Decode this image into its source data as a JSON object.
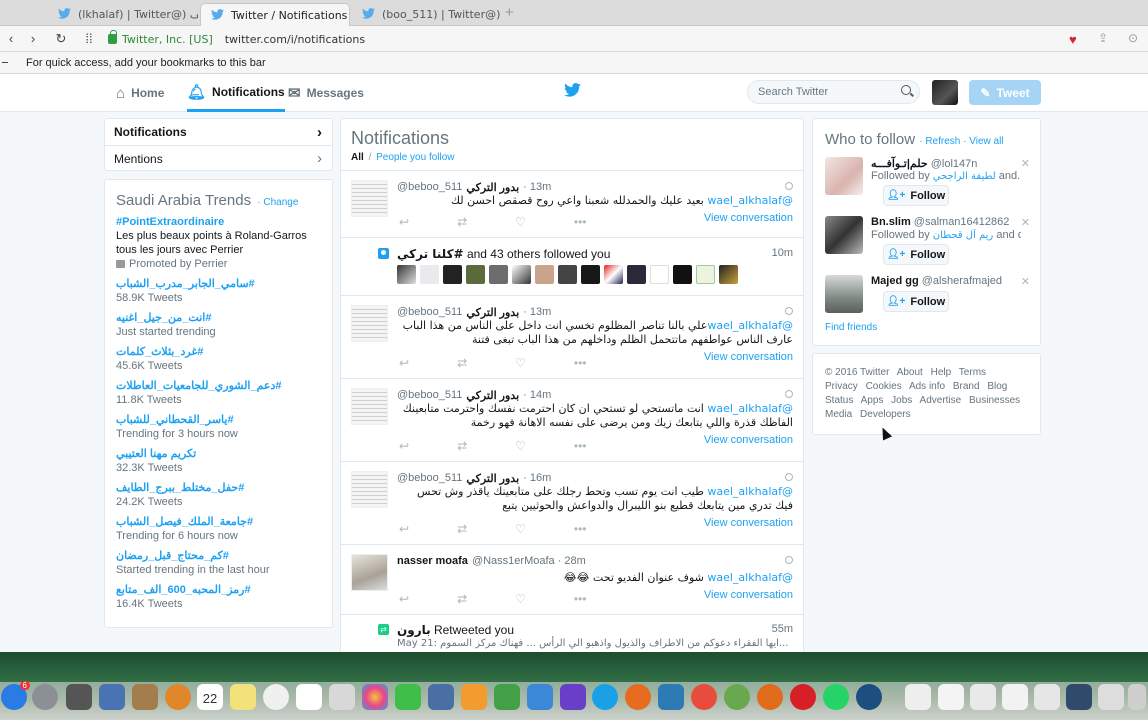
{
  "browser": {
    "tabs": [
      {
        "label": "(lkhalaf) | Twitter@) وائل الخلف"
      },
      {
        "label": "Twitter / Notifications"
      },
      {
        "label": "(boo_511) | Twitter@) بدور التركي"
      }
    ],
    "url_owner": "Twitter, Inc. [US]",
    "url": "twitter.com/i/notifications",
    "bookmarks_hint": "For quick access, add your bookmarks to this bar"
  },
  "nav": {
    "home": "Home",
    "notifications": "Notifications",
    "messages": "Messages",
    "search_placeholder": "Search Twitter",
    "tweet_button": "Tweet"
  },
  "left_menu": {
    "items": [
      {
        "label": "Notifications"
      },
      {
        "label": "Mentions"
      }
    ]
  },
  "trends": {
    "title": "Saudi Arabia Trends",
    "change": "Change",
    "items": [
      {
        "name": "#PointExtraordinaire",
        "desc": "Les plus beaux points à Roland-Garros tous les jours avec Perrier",
        "meta": "Promoted by Perrier"
      },
      {
        "name": "#سامي_الجابر_مدرب_الشباب",
        "meta": "58.9K Tweets"
      },
      {
        "name": "#انت_من_جيل_اغنيه",
        "meta": "Just started trending"
      },
      {
        "name": "#غرد_بثلاث_كلمات",
        "meta": "45.6K Tweets"
      },
      {
        "name": "#دعم_الشوري_للجامعيات_العاطلات",
        "meta": "11.8K Tweets"
      },
      {
        "name": "#ياسر_القحطاني_للشباب",
        "meta": "Trending for 3 hours now"
      },
      {
        "name": "تكريم مهنا العتيبي",
        "meta": "32.3K Tweets"
      },
      {
        "name": "#حفل_مختلط_ببرج_الطايف",
        "meta": "24.2K Tweets"
      },
      {
        "name": "#جامعة_الملك_فيصل_الشباب",
        "meta": "Trending for 6 hours now"
      },
      {
        "name": "#كم_محتاج_قبل_رمضان",
        "meta": "Started trending in the last hour"
      },
      {
        "name": "#رمز_المحبه_600_الف_متابع",
        "meta": "16.4K Tweets"
      }
    ]
  },
  "stream": {
    "title": "Notifications",
    "filter_all": "All",
    "filter_separator": "/",
    "filter_people": "People you follow",
    "view_conversation": "View conversation",
    "tweets": [
      {
        "name": "بدور التركي",
        "handle": "@beboo_511",
        "time": "· 13m",
        "mention": "@wael_alkhalaf",
        "text": "بعيد عليك والحمدلله شعبنا واعي روح قصقص احسن لك"
      },
      {
        "name": "بدور التركي",
        "handle": "@beboo_511",
        "time": "· 13m",
        "mention": "@wael_alkhalaf",
        "text": "علي بالنا تناصر المظلوم تخسي انت داخل على الناس من هذا الباب عارف الناس عواطفهم ماتتحمل الظلم وداخلهم من هذا الباب تبغى فتنة"
      },
      {
        "name": "بدور التركي",
        "handle": "@beboo_511",
        "time": "· 14m",
        "mention": "@wael_alkhalaf",
        "text": "انت ماتستحي لو تستحي ان كان احترمت نفسك واحترمت متابعينك الفاظك قذرة واللي يتابعك زيك ومن يرضى على نفسه الاهانة فهو رخمة"
      },
      {
        "name": "بدور التركي",
        "handle": "@beboo_511",
        "time": "· 16m",
        "mention": "@wael_alkhalaf",
        "text": "طيب انت يوم تسب وتحط رجلك على متابعينك ياقذر وش تحس فيك تدري مين يتابعك قطيع بنو الليبرال والدواعش والحوثيين يتبع"
      },
      {
        "name": "nasser moafa",
        "handle": "@Nass1erMoafa",
        "time": "· 28m",
        "mention": "@wael_alkhalaf",
        "text": "شوف عنوان الفديو تحت 😂😂"
      }
    ],
    "follow_notice": {
      "name": "#كلنا تركي",
      "rest": "and 43 others followed you",
      "time": "10m"
    },
    "retweet_notice": {
      "name": "بارون",
      "rest": "Retweeted you",
      "time": "55m",
      "preview": "May 21: ايها الفقراء دعوكم من الاطراف والذيول واذهبو الي الرأس ... فهناك مركز السموم..."
    }
  },
  "who_to_follow": {
    "title": "Who to follow",
    "refresh": "· Refresh",
    "view_all": "· View all",
    "follow_label": "Follow",
    "find_friends": "Find friends",
    "suggestions": [
      {
        "name": "حلم|تـوآفـــه",
        "handle": "@lol147n",
        "followed_prefix": "Followed by",
        "followed_names": "لطيفة الراجحي",
        "followed_suffix": "and..."
      },
      {
        "name": "Bn.slim",
        "handle": "@salman16412862",
        "followed_prefix": "Followed by",
        "followed_names": "ريم آل قحطان",
        "followed_suffix": "and o..."
      },
      {
        "name": "Majed gg",
        "handle": "@alsherafmajed",
        "followed_prefix": "",
        "followed_names": "",
        "followed_suffix": ""
      }
    ]
  },
  "footer": {
    "links": [
      "© 2016 Twitter",
      "About",
      "Help",
      "Terms",
      "Privacy",
      "Cookies",
      "Ads info",
      "Brand",
      "Blog",
      "Status",
      "Apps",
      "Jobs",
      "Advertise",
      "Businesses",
      "Media",
      "Developers"
    ]
  },
  "dock": {
    "calendar_day": "22",
    "badge_count": "6"
  },
  "colors": {
    "accent": "#1da1f2",
    "muted": "#66757f",
    "retweet": "#19cf86",
    "heart": "#dd2233"
  }
}
